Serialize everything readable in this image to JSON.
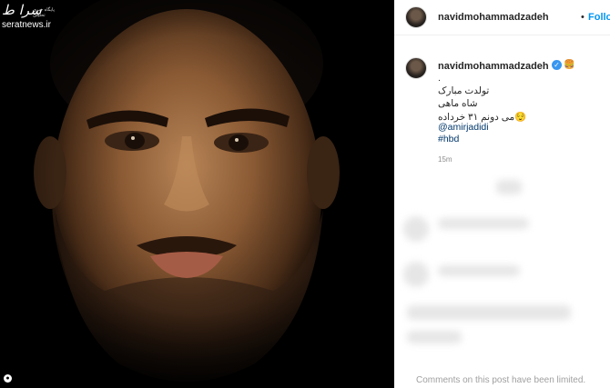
{
  "watermark": {
    "logo": "سرا ط",
    "tagline": "پایگاه خبری تحلیلی",
    "site": "seratnews.ir"
  },
  "post": {
    "username": "navidmohammadzadeh",
    "header_separator": "•",
    "follow_label": "Follow",
    "more_label": "...",
    "caption": {
      "username": "navidmohammadzadeh",
      "username_emoji": "🍔",
      "lines": [
        ".",
        "تولدت مبارک",
        "شاه ماهی",
        "😌می دونم ۳۱ خرداده",
        "@amirjadidi",
        "#hbd"
      ]
    },
    "time_ago": "15m",
    "comments_limited": "Comments on this post have been limited."
  },
  "colors": {
    "link": "#00376b",
    "follow": "#0095f6",
    "verified": "#3897f0"
  },
  "icons": {
    "verified": "verified-badge-icon",
    "photo_info": "person-tag-icon"
  }
}
